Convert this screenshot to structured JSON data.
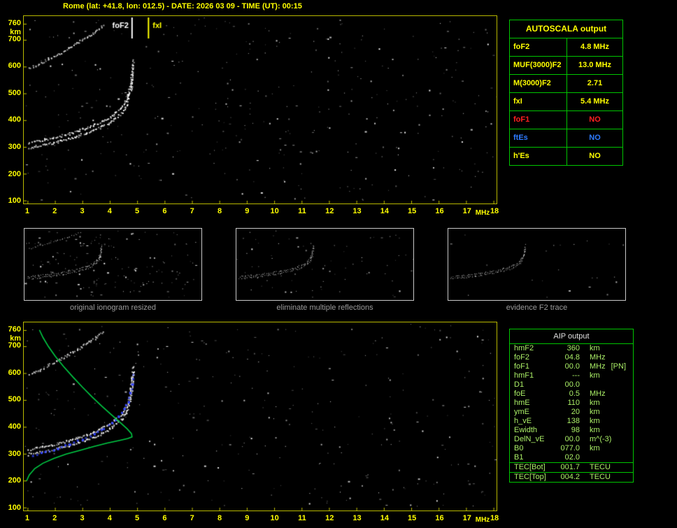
{
  "header": {
    "title": "Rome (lat: +41.8, lon: 012.5) - DATE: 2026 03 09 - TIME (UT): 00:15"
  },
  "colors": {
    "accent_yellow": "#ffff00",
    "plot_border_yellow": "#b8b800",
    "table_border_green": "#00c400",
    "no_red": "#ff2020",
    "es_blue": "#2e7bff",
    "aip_text_green": "#aaee66",
    "profile_green": "#00cc44",
    "fitted_blue": "#3344ff",
    "caption_gray": "#9a9a9a"
  },
  "autoscala": {
    "title": "AUTOSCALA output",
    "rows": [
      {
        "label": "foF2",
        "value": "4.8 MHz",
        "color": "#ffff00"
      },
      {
        "label": "MUF(3000)F2",
        "value": "13.0 MHz",
        "color": "#ffff00"
      },
      {
        "label": "M(3000)F2",
        "value": "2.71",
        "color": "#ffff00"
      },
      {
        "label": "fxI",
        "value": "5.4 MHz",
        "color": "#ffff00"
      },
      {
        "label": "foF1",
        "value": "NO",
        "color": "#ff2020"
      },
      {
        "label": "ftEs",
        "value": "NO",
        "color": "#2e7bff"
      },
      {
        "label": "h'Es",
        "value": "NO",
        "color": "#ffff00"
      }
    ]
  },
  "aip": {
    "title": "AIP output",
    "rows": [
      {
        "label": "hmF2",
        "value": "360",
        "unit": "km"
      },
      {
        "label": "foF2",
        "value": "04.8",
        "unit": "MHz"
      },
      {
        "label": "foF1",
        "value": "00.0",
        "unit": "MHz",
        "extra": "[PN]"
      },
      {
        "label": "hmF1",
        "value": "---",
        "unit": "km"
      },
      {
        "label": "D1",
        "value": "00.0",
        "unit": ""
      },
      {
        "label": "foE",
        "value": "0.5",
        "unit": "MHz"
      },
      {
        "label": "hmE",
        "value": "110",
        "unit": "km"
      },
      {
        "label": "ymE",
        "value": "20",
        "unit": "km"
      },
      {
        "label": "h_vE",
        "value": "138",
        "unit": "km"
      },
      {
        "label": "Ewidth",
        "value": "98",
        "unit": "km"
      },
      {
        "label": "DelN_vE",
        "value": "00.0",
        "unit": "m^(-3)"
      },
      {
        "label": "B0",
        "value": "077.0",
        "unit": "km"
      },
      {
        "label": "B1",
        "value": "02.0",
        "unit": ""
      },
      {
        "label": "TEC[Bot]",
        "value": "001.7",
        "unit": "TECU",
        "sep_above": true
      },
      {
        "label": "TEC[Top]",
        "value": "004.2",
        "unit": "TECU",
        "sep_above": true
      }
    ]
  },
  "thumbnails": [
    {
      "caption": "original ionogram resized",
      "noise_dots": 160,
      "show_second_hop": true
    },
    {
      "caption": "eliminate multiple reflections",
      "noise_dots": 70,
      "show_second_hop": false
    },
    {
      "caption": "evidence F2 trace",
      "noise_dots": 22,
      "show_second_hop": false
    }
  ],
  "chart_data": [
    {
      "id": "main-ionogram",
      "type": "scatter",
      "title": "ionogram with autoscaled characteristics",
      "xlabel": "MHz",
      "ylabel": "km",
      "xlim": [
        0.85,
        18.1
      ],
      "ylim": [
        90,
        790
      ],
      "x_ticks": [
        1,
        2,
        3,
        4,
        5,
        6,
        7,
        8,
        9,
        10,
        11,
        12,
        13,
        14,
        15,
        16,
        17,
        18
      ],
      "y_ticks": [
        760,
        700,
        600,
        500,
        400,
        300,
        200,
        100
      ],
      "x_unit": "MHz",
      "y_unit": "km",
      "noise_dots": 380,
      "series": [
        {
          "name": "F2-trace",
          "color": "#ffffff",
          "double": true,
          "points": [
            [
              1.0,
              300
            ],
            [
              1.3,
              306
            ],
            [
              1.6,
              312
            ],
            [
              1.9,
              318
            ],
            [
              2.2,
              326
            ],
            [
              2.5,
              334
            ],
            [
              2.8,
              344
            ],
            [
              3.1,
              354
            ],
            [
              3.4,
              366
            ],
            [
              3.7,
              380
            ],
            [
              4.0,
              396
            ],
            [
              4.2,
              412
            ],
            [
              4.4,
              432
            ],
            [
              4.55,
              455
            ],
            [
              4.65,
              480
            ],
            [
              4.72,
              508
            ],
            [
              4.77,
              540
            ],
            [
              4.8,
              575
            ],
            [
              4.82,
              612
            ]
          ]
        },
        {
          "name": "F2-second-hop",
          "color": "#e0e0e0",
          "points": [
            [
              1.05,
              596
            ],
            [
              1.4,
              614
            ],
            [
              1.75,
              632
            ],
            [
              2.1,
              650
            ],
            [
              2.45,
              670
            ],
            [
              2.8,
              692
            ],
            [
              3.15,
              714
            ],
            [
              3.5,
              738
            ],
            [
              3.75,
              756
            ]
          ]
        }
      ],
      "markers": [
        {
          "label": "foF2",
          "freq": 4.8,
          "color": "#ffffff",
          "side": "left"
        },
        {
          "label": "fxI",
          "freq": 5.4,
          "color": "#ffff00",
          "side": "right"
        }
      ]
    },
    {
      "id": "profile-ionogram",
      "type": "scatter",
      "title": "ionogram with fitted trace and electron density profile",
      "xlabel": "MHz",
      "ylabel": "km",
      "xlim": [
        0.85,
        18.1
      ],
      "ylim": [
        90,
        790
      ],
      "x_ticks": [
        1,
        2,
        3,
        4,
        5,
        6,
        7,
        8,
        9,
        10,
        11,
        12,
        13,
        14,
        15,
        16,
        17,
        18
      ],
      "y_ticks": [
        760,
        700,
        600,
        500,
        400,
        300,
        200,
        100
      ],
      "x_unit": "MHz",
      "y_unit": "km",
      "noise_dots": 330,
      "series": [
        {
          "name": "F2-trace",
          "color": "#ffffff",
          "double": true,
          "points": [
            [
              1.0,
              300
            ],
            [
              1.3,
              306
            ],
            [
              1.6,
              312
            ],
            [
              1.9,
              318
            ],
            [
              2.2,
              326
            ],
            [
              2.5,
              334
            ],
            [
              2.8,
              344
            ],
            [
              3.1,
              354
            ],
            [
              3.4,
              366
            ],
            [
              3.7,
              380
            ],
            [
              4.0,
              396
            ],
            [
              4.2,
              412
            ],
            [
              4.4,
              432
            ],
            [
              4.55,
              455
            ],
            [
              4.65,
              480
            ],
            [
              4.72,
              508
            ],
            [
              4.77,
              540
            ],
            [
              4.8,
              575
            ],
            [
              4.82,
              612
            ]
          ]
        },
        {
          "name": "F2-second-hop",
          "color": "#e0e0e0",
          "points": [
            [
              1.05,
              596
            ],
            [
              1.4,
              614
            ],
            [
              1.75,
              632
            ],
            [
              2.1,
              650
            ],
            [
              2.45,
              670
            ],
            [
              2.8,
              692
            ],
            [
              3.15,
              714
            ],
            [
              3.5,
              738
            ],
            [
              3.75,
              756
            ]
          ]
        },
        {
          "name": "autoscala-fitted-trace",
          "color": "#3344ff",
          "dotsize": 3,
          "step": 6,
          "jitter": 2,
          "points": [
            [
              1.15,
              298
            ],
            [
              1.6,
              310
            ],
            [
              2.05,
              324
            ],
            [
              2.5,
              340
            ],
            [
              2.95,
              357
            ],
            [
              3.4,
              377
            ],
            [
              3.75,
              398
            ],
            [
              4.05,
              420
            ],
            [
              4.3,
              444
            ],
            [
              4.5,
              470
            ],
            [
              4.63,
              498
            ],
            [
              4.72,
              530
            ],
            [
              4.78,
              562
            ],
            [
              4.82,
              600
            ]
          ]
        },
        {
          "name": "electron-density-profile",
          "color": "#00cc44",
          "line": true,
          "points": [
            [
              0.95,
              200
            ],
            [
              1.05,
              222
            ],
            [
              1.25,
              246
            ],
            [
              1.55,
              266
            ],
            [
              1.95,
              284
            ],
            [
              2.4,
              300
            ],
            [
              2.9,
              314
            ],
            [
              3.4,
              328
            ],
            [
              3.9,
              341
            ],
            [
              4.35,
              351
            ],
            [
              4.65,
              358
            ],
            [
              4.8,
              364
            ],
            [
              4.78,
              376
            ],
            [
              4.62,
              394
            ],
            [
              4.36,
              418
            ],
            [
              4.05,
              446
            ],
            [
              3.7,
              478
            ],
            [
              3.35,
              512
            ],
            [
              3.0,
              548
            ],
            [
              2.65,
              586
            ],
            [
              2.3,
              626
            ],
            [
              2.0,
              664
            ],
            [
              1.75,
              700
            ],
            [
              1.55,
              734
            ],
            [
              1.42,
              762
            ]
          ]
        }
      ],
      "markers": []
    }
  ]
}
